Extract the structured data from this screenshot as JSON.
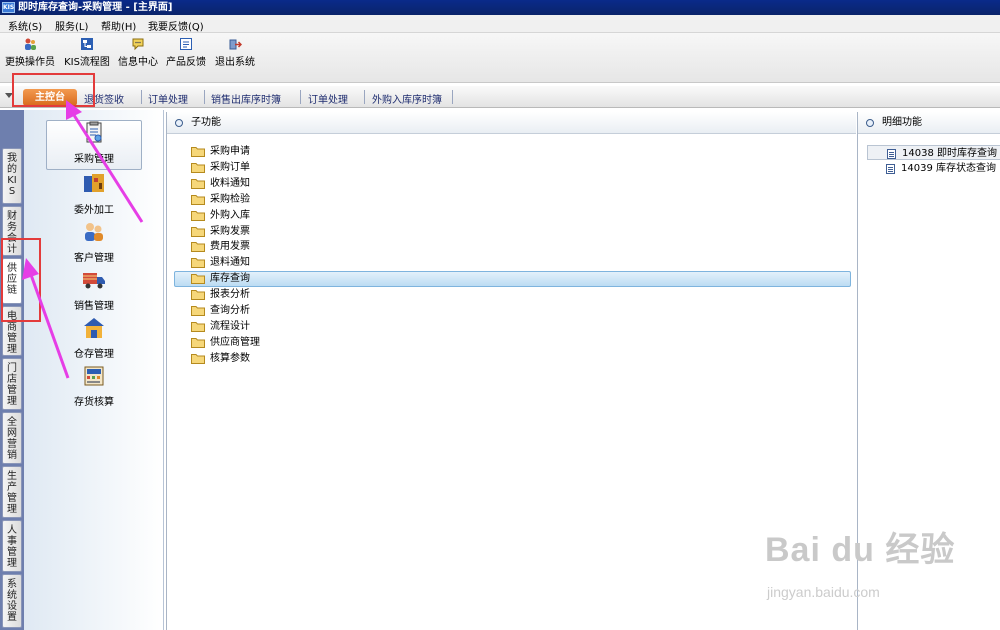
{
  "window": {
    "icon_text": "KIS",
    "title": "即时库存查询-采购管理 - [主界面]"
  },
  "menu": [
    "系统(S)",
    "服务(L)",
    "帮助(H)",
    "我要反馈(Q)"
  ],
  "toolbar": [
    {
      "label": "更换操作员",
      "icon": "change-operator-icon"
    },
    {
      "label": "KIS流程图",
      "icon": "flowchart-icon"
    },
    {
      "label": "信息中心",
      "icon": "message-center-icon"
    },
    {
      "label": "产品反馈",
      "icon": "feedback-icon"
    },
    {
      "label": "退出系统",
      "icon": "exit-icon"
    }
  ],
  "tabs": {
    "active": "主控台",
    "items": [
      "退货签收",
      "订单处理",
      "销售出库序时簿",
      "订单处理",
      "外购入库序时簿"
    ]
  },
  "left_nav": [
    "我的KIS",
    "财务会计",
    "供应链",
    "电商管理",
    "门店管理",
    "全网营销",
    "生产管理",
    "人事管理",
    "系统设置"
  ],
  "modules": [
    {
      "label": "采购管理",
      "icon": "purchase-icon"
    },
    {
      "label": "委外加工",
      "icon": "outsourcing-icon"
    },
    {
      "label": "客户管理",
      "icon": "customer-icon"
    },
    {
      "label": "销售管理",
      "icon": "sales-truck-icon"
    },
    {
      "label": "仓存管理",
      "icon": "warehouse-icon"
    },
    {
      "label": "存货核算",
      "icon": "inventory-accounting-icon"
    }
  ],
  "subfunctions": {
    "header": "子功能",
    "items": [
      "采购申请",
      "采购订单",
      "收料通知",
      "采购检验",
      "外购入库",
      "采购发票",
      "费用发票",
      "退料通知",
      "库存查询",
      "报表分析",
      "查询分析",
      "流程设计",
      "供应商管理",
      "核算参数"
    ],
    "selected": "库存查询"
  },
  "details": {
    "header": "明细功能",
    "items": [
      {
        "code": "14038",
        "label": "即时库存查询"
      },
      {
        "code": "14039",
        "label": "库存状态查询"
      }
    ]
  },
  "watermark": {
    "brand": "Bai du 经验",
    "sub": "jingyan.baidu.com"
  },
  "colors": {
    "title_bar": "#0a246a",
    "active_tab": "#e07a2a",
    "annotation_box": "#e33b3b",
    "annotation_arrow": "#e63ee6",
    "selection": "#bcdcf3"
  }
}
